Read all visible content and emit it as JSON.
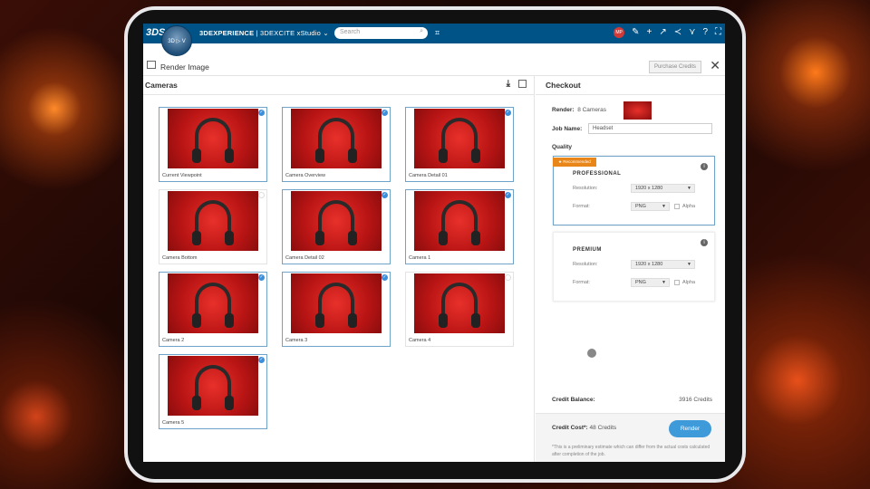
{
  "topbar": {
    "logo": "3DS",
    "compass": "3D ▷ V",
    "brand_bold": "3DEXPERIENCE",
    "brand_rest": " | 3DEXCITE  xStudio ⌄",
    "search_placeholder": "Search",
    "avatar": "MP"
  },
  "header": {
    "title": "Render Image",
    "purchase_credits": "Purchase Credits",
    "close": "✕"
  },
  "cameras": {
    "title": "Cameras",
    "items": [
      {
        "label": "Current Viewpoint",
        "selected": true
      },
      {
        "label": "Camera Overview",
        "selected": true
      },
      {
        "label": "Camera Detail 01",
        "selected": true
      },
      {
        "label": "Camera Bottom",
        "selected": false
      },
      {
        "label": "Camera Detail 02",
        "selected": true
      },
      {
        "label": "Camera 1",
        "selected": true
      },
      {
        "label": "Camera 2",
        "selected": true
      },
      {
        "label": "Camera 3",
        "selected": true
      },
      {
        "label": "Camera 4",
        "selected": false
      },
      {
        "label": "Camera 5",
        "selected": true
      }
    ]
  },
  "checkout": {
    "title": "Checkout",
    "render_label": "Render:",
    "render_value": "8 Cameras",
    "job_label": "Job Name:",
    "job_value": "Headset",
    "quality_label": "Quality",
    "options": [
      {
        "badge": "Recommended",
        "name": "PROFESSIONAL",
        "resolution_label": "Resolution:",
        "resolution": "1920 x 1280",
        "format_label": "Format:",
        "format": "PNG",
        "alpha": "Alpha",
        "active": true
      },
      {
        "badge": "",
        "name": "PREMIUM",
        "resolution_label": "Resolution:",
        "resolution": "1920 x 1280",
        "format_label": "Format:",
        "format": "PNG",
        "alpha": "Alpha",
        "active": false
      }
    ],
    "balance_label": "Credit Balance:",
    "balance_value": "3916 Credits",
    "cost_label": "Credit Cost*:",
    "cost_value": "48 Credits",
    "render_button": "Render",
    "disclaimer": "*This is a preliminary estimate which can differ from the actual costs calculated after completion of the job."
  },
  "colors": {
    "topbar": "#005386",
    "accent": "#3f9ad9",
    "recommended": "#e8861a"
  }
}
